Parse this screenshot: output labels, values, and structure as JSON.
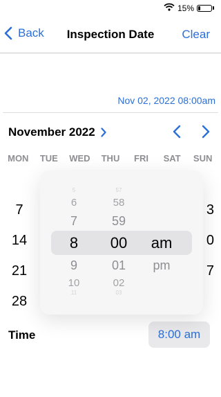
{
  "status_bar": {
    "battery_percent": "15%",
    "battery_level": 0.15
  },
  "nav": {
    "back_label": "Back",
    "title": "Inspection Date",
    "clear_label": "Clear"
  },
  "selected_datetime": "Nov 02, 2022 08:00am",
  "calendar": {
    "month_label": "November 2022",
    "weekdays": [
      "MON",
      "TUE",
      "WED",
      "THU",
      "FRI",
      "SAT",
      "SUN"
    ],
    "visible_days_col0": [
      "7",
      "14",
      "21",
      "28"
    ],
    "visible_days_col6": [
      "3",
      "0",
      "7"
    ]
  },
  "time": {
    "label": "Time",
    "value": "8:00 am"
  },
  "time_picker": {
    "hours": {
      "tiny": "5",
      "far2": "6",
      "near": "7",
      "selected": "8",
      "after_near": "9",
      "after_far": "10",
      "after_tiny": "11"
    },
    "minutes": {
      "tiny": "57",
      "far2": "58",
      "near": "59",
      "selected": "00",
      "after_near": "01",
      "after_far": "02",
      "after_tiny": "03"
    },
    "ampm": {
      "selected": "am",
      "after_near": "pm"
    }
  },
  "colors": {
    "accent": "#2b6fd6",
    "muted": "#8e8e93",
    "button_bg": "#e9e9ec"
  }
}
